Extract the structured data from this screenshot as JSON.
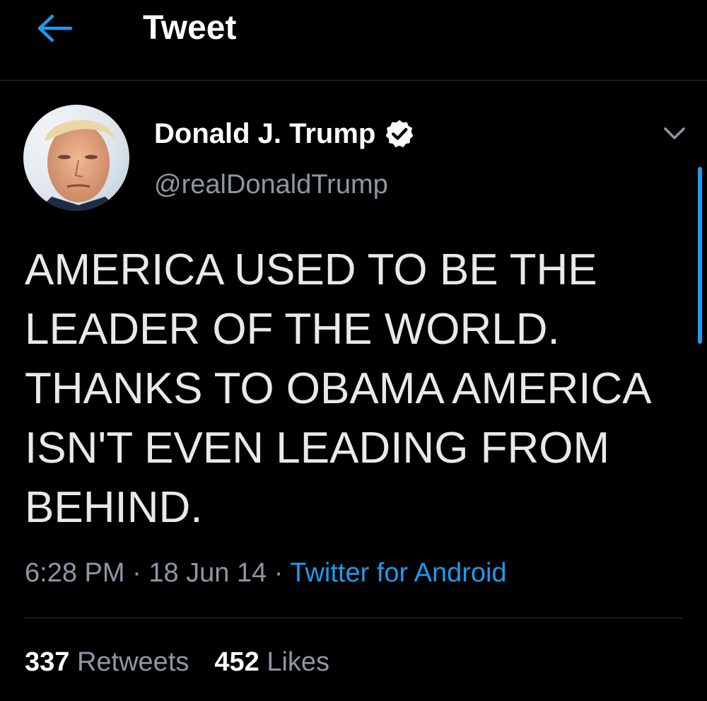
{
  "header": {
    "title": "Tweet",
    "back_icon": "arrow-left-icon",
    "accent_color": "#1d9bf0"
  },
  "author": {
    "name": "Donald J. Trump",
    "handle": "@realDonaldTrump",
    "verified": true,
    "verified_icon": "verified-badge-icon",
    "avatar": "avatar"
  },
  "tweet": {
    "text": "AMERICA USED TO BE THE\nLEADER OF THE WORLD.\nTHANKS TO OBAMA AMERICA\nISN'T EVEN LEADING FROM\nBEHIND.",
    "time": "6:28 PM",
    "separator": "·",
    "date": "18 Jun 14",
    "source": "Twitter for Android",
    "more_icon": "chevron-down-icon"
  },
  "stats": {
    "retweets_count": "337",
    "retweets_label": "Retweets",
    "likes_count": "452",
    "likes_label": "Likes"
  }
}
